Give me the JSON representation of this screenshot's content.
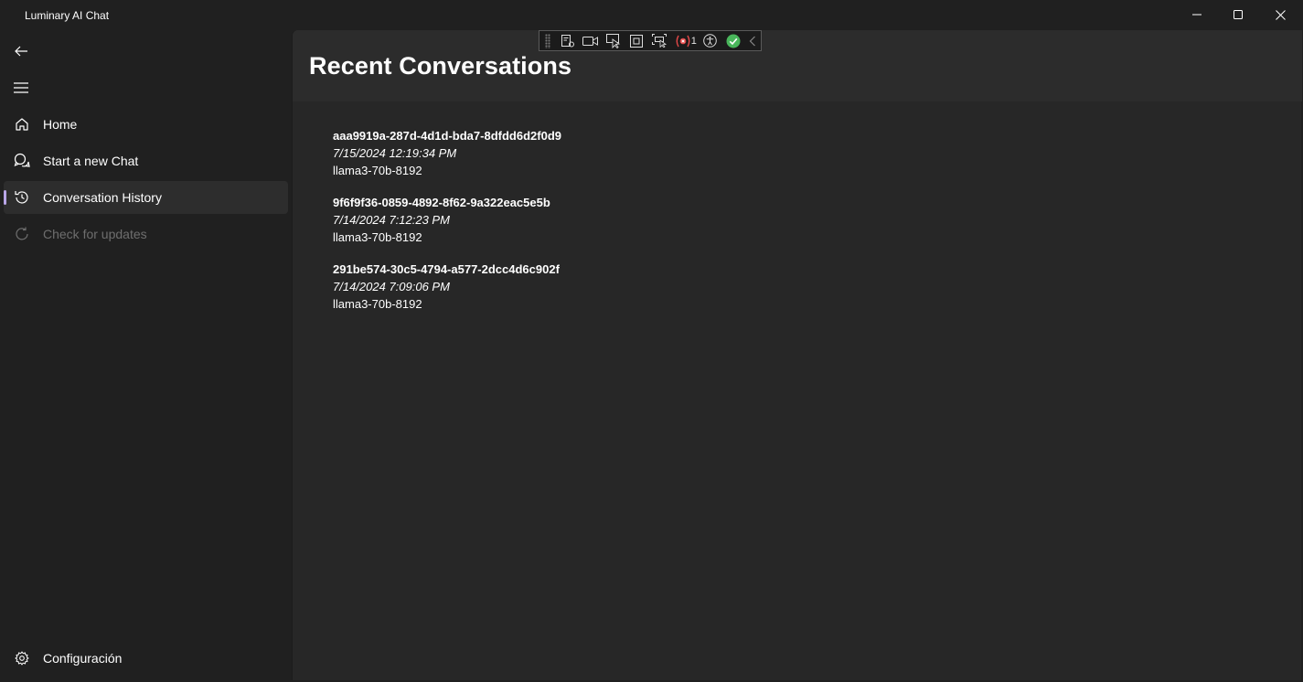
{
  "window": {
    "title": "Luminary AI Chat"
  },
  "debug_toolbar": {
    "error_count": "1"
  },
  "sidebar": {
    "items": [
      {
        "label": "Home",
        "icon": "home-icon"
      },
      {
        "label": "Start a new Chat",
        "icon": "chat-icon"
      },
      {
        "label": "Conversation History",
        "icon": "history-icon",
        "selected": true
      },
      {
        "label": "Check for updates",
        "icon": "refresh-icon",
        "disabled": true
      }
    ],
    "settings_label": "Configuración"
  },
  "main": {
    "title": "Recent Conversations",
    "conversations": [
      {
        "id": "aaa9919a-287d-4d1d-bda7-8dfdd6d2f0d9",
        "date": "7/15/2024 12:19:34 PM",
        "model": "llama3-70b-8192"
      },
      {
        "id": "9f6f9f36-0859-4892-8f62-9a322eac5e5b",
        "date": "7/14/2024 7:12:23 PM",
        "model": "llama3-70b-8192"
      },
      {
        "id": "291be574-30c5-4794-a577-2dcc4d6c902f",
        "date": "7/14/2024 7:09:06 PM",
        "model": "llama3-70b-8192"
      }
    ]
  },
  "colors": {
    "background": "#202020",
    "content": "#272727",
    "header": "#2c2c2c",
    "selection_indicator": "#b9a6e8"
  }
}
